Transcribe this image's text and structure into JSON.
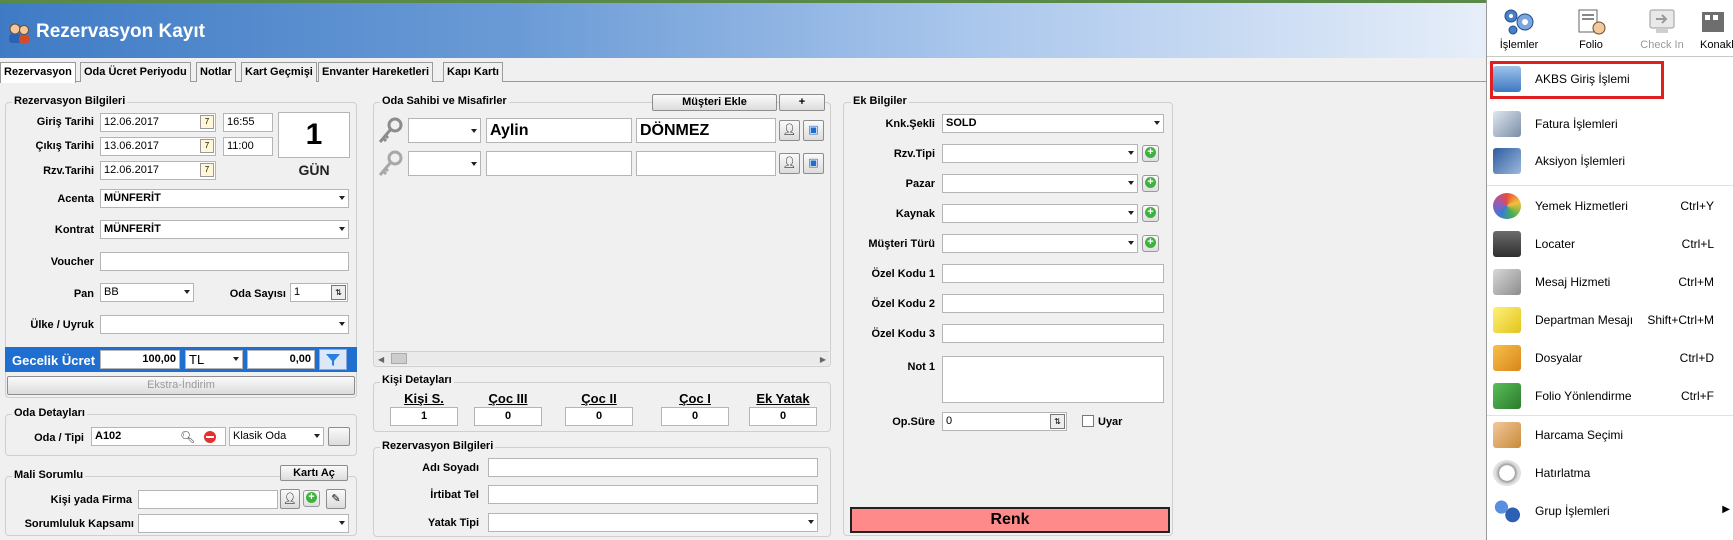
{
  "window": {
    "title": "Rezervasyon Kayıt"
  },
  "tabs": [
    "Rezervasyon",
    "Oda Ücret Periyodu",
    "Notlar",
    "Kart Geçmişi",
    "Envanter Hareketleri",
    "Kapı Kartı"
  ],
  "rez_bilgileri": {
    "title": "Rezervasyon Bilgileri",
    "giris_label": "Giriş Tarihi",
    "giris_date": "12.06.2017",
    "giris_time": "16:55",
    "cikis_label": "Çıkış Tarihi",
    "cikis_date": "13.06.2017",
    "cikis_time": "11:00",
    "rzv_label": "Rzv.Tarihi",
    "rzv_date": "12.06.2017",
    "nights": "1",
    "nights_unit": "GÜN",
    "acenta_label": "Acenta",
    "acenta": "MÜNFERİT",
    "kontrat_label": "Kontrat",
    "kontrat": "MÜNFERİT",
    "voucher_label": "Voucher",
    "voucher": "",
    "pan_label": "Pan",
    "pan": "BB",
    "oda_sayisi_label": "Oda Sayısı",
    "oda_sayisi": "1",
    "ulke_label": "Ülke / Uyruk",
    "ulke": ""
  },
  "gecelik": {
    "label": "Gecelik Ücret",
    "amount": "100,00",
    "currency": "TL",
    "extra": "0,00",
    "ekstra_button": "Ekstra-İndirim"
  },
  "oda_detaylari": {
    "title": "Oda Detayları",
    "label": "Oda / Tipi",
    "oda": "A102",
    "tip": "Klasik Oda"
  },
  "mali_sorumlu": {
    "title": "Mali Sorumlu",
    "kart_ac": "Kartı Aç",
    "kisi_label": "Kişi yada Firma",
    "kapsam_label": "Sorumluluk Kapsamı"
  },
  "misafirler": {
    "title": "Oda Sahibi ve Misafirler",
    "musteri_ekle": "Müşteri Ekle",
    "plus": "+",
    "rows": [
      {
        "title": "",
        "first": "Aylin",
        "last": "DÖNMEZ"
      },
      {
        "title": "",
        "first": "",
        "last": ""
      }
    ]
  },
  "kisi_detaylari": {
    "title": "Kişi Detayları",
    "columns": [
      {
        "label": "Kişi S.",
        "value": "1"
      },
      {
        "label": "Çoc III",
        "value": "0"
      },
      {
        "label": "Çoc II",
        "value": "0"
      },
      {
        "label": "Çoc I",
        "value": "0"
      },
      {
        "label": "Ek Yatak",
        "value": "0"
      }
    ]
  },
  "rez_bilgileri2": {
    "title": "Rezervasyon Bilgileri",
    "adi_label": "Adı Soyadı",
    "irtibat_label": "İrtibat Tel",
    "yatak_label": "Yatak Tipi"
  },
  "ek_bilgiler": {
    "title": "Ek Bilgiler",
    "knk_label": "Knk.Şekli",
    "knk": "SOLD",
    "rzv_tipi_label": "Rzv.Tipi",
    "pazar_label": "Pazar",
    "kaynak_label": "Kaynak",
    "musteri_turu_label": "Müşteri Türü",
    "ozel1_label": "Özel Kodu 1",
    "ozel2_label": "Özel Kodu 2",
    "ozel3_label": "Özel Kodu 3",
    "not1_label": "Not 1",
    "opsure_label": "Op.Süre",
    "opsure": "0",
    "uyar_label": "Uyar",
    "renk_label": "Renk",
    "renk_color": "#ff8a8a"
  },
  "toolbar": [
    {
      "label": "İşlemler",
      "icon": "gears-icon"
    },
    {
      "label": "Folio",
      "icon": "folio-icon"
    },
    {
      "label": "Check In",
      "icon": "check-in-icon"
    },
    {
      "label": "Konakla",
      "icon": "konaklama-icon"
    }
  ],
  "menu": [
    {
      "label": "AKBS Giriş İşlemi",
      "shortcut": "",
      "icon": "akbs-icon"
    },
    {
      "label": "Fatura İşlemleri",
      "shortcut": "",
      "icon": "invoice-icon"
    },
    {
      "label": "Aksiyon İşlemleri",
      "shortcut": "",
      "icon": "action-icon"
    },
    {
      "label": "Yemek Hizmetleri",
      "shortcut": "Ctrl+Y",
      "icon": "food-icon"
    },
    {
      "label": "Locater",
      "shortcut": "Ctrl+L",
      "icon": "camera-icon"
    },
    {
      "label": "Mesaj Hizmeti",
      "shortcut": "Ctrl+M",
      "icon": "mail-icon"
    },
    {
      "label": "Departman Mesajı",
      "shortcut": "Shift+Ctrl+M",
      "icon": "note-icon"
    },
    {
      "label": "Dosyalar",
      "shortcut": "Ctrl+D",
      "icon": "folder-icon"
    },
    {
      "label": "Folio Yönlendirme",
      "shortcut": "Ctrl+F",
      "icon": "redirect-icon"
    },
    {
      "label": "Harcama Seçimi",
      "shortcut": "",
      "icon": "spending-icon"
    },
    {
      "label": "Hatırlatma",
      "shortcut": "",
      "icon": "reminder-icon"
    },
    {
      "label": "Grup İşlemleri",
      "shortcut": "",
      "icon": "group-icon"
    }
  ],
  "colors": {
    "title_blue": "#3f7bc5",
    "highlight_red": "#e02020",
    "gecelik_bg": "#1f6fd0"
  }
}
